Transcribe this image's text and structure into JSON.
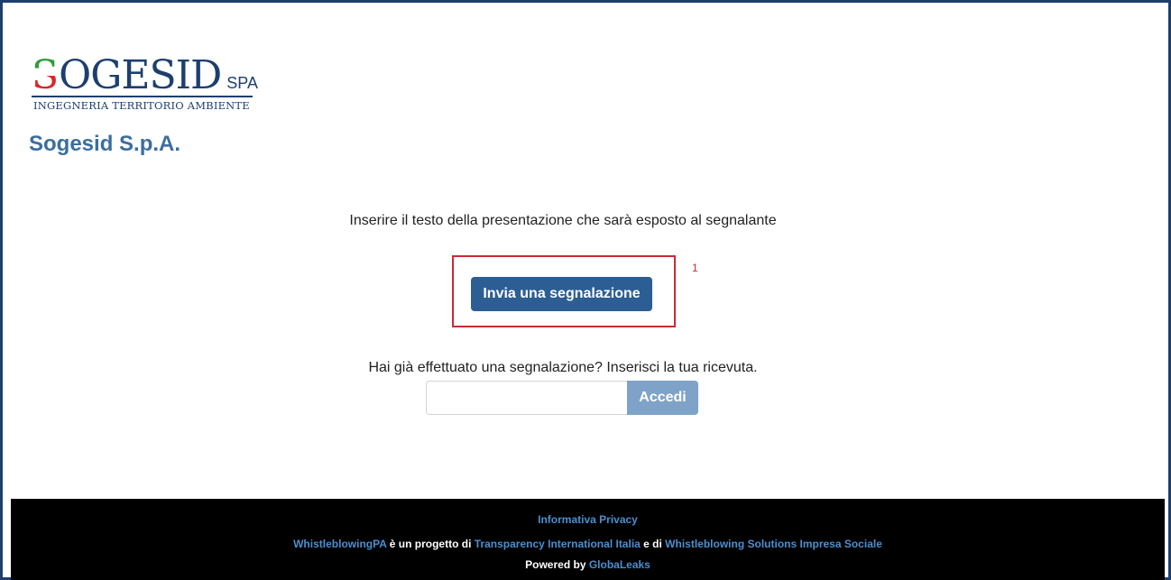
{
  "logo": {
    "first_letter": "S",
    "rest": "OGESID",
    "suffix": "SPA",
    "tagline": "INGEGNERIA TERRITORIO AMBIENTE"
  },
  "site_title": "Sogesid S.p.A.",
  "intro_text": "Inserire il testo della presentazione che sarà esposto al segnalante",
  "submit_button_label": "Invia una segnalazione",
  "annotation_number": "1",
  "receipt": {
    "label": "Hai già effettuato una segnalazione? Inserisci la tua ricevuta.",
    "input_value": "",
    "login_label": "Accedi"
  },
  "footer": {
    "privacy_link": "Informativa Privacy",
    "project_link": "WhistleblowingPA",
    "text_1": " è un progetto di ",
    "ti_link": "Transparency International Italia",
    "text_2": " e di ",
    "ws_link": "Whistleblowing Solutions Impresa Sociale",
    "powered_by": "Powered by ",
    "globaleaks_link": "GlobaLeaks"
  },
  "colors": {
    "frame_border": "#1e3f6e",
    "primary_button": "#2c5e93",
    "login_button": "#7fa3c8",
    "annotation_red": "#cc2a36",
    "footer_link": "#4a8fd1"
  }
}
